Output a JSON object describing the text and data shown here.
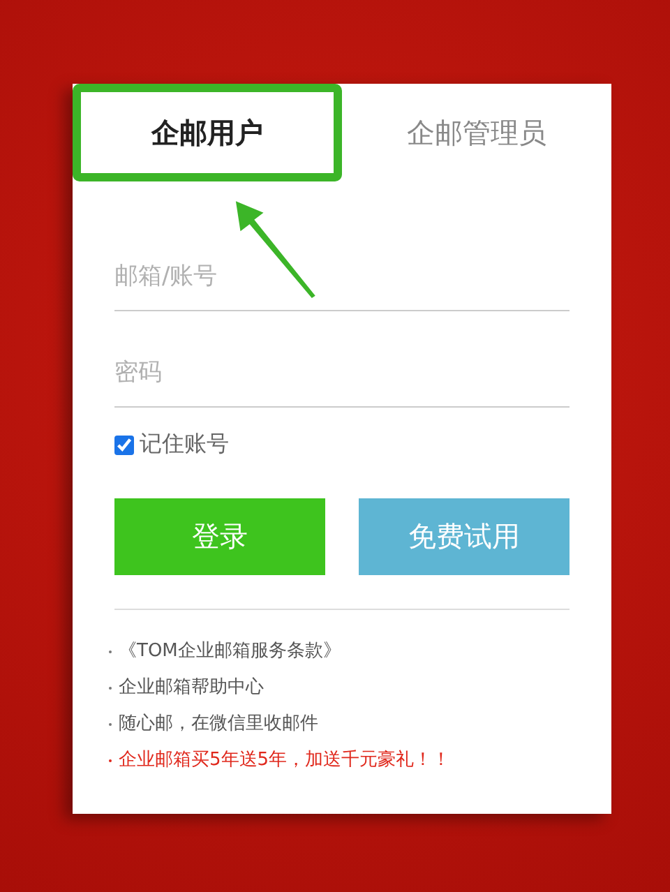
{
  "tabs": [
    {
      "label": "企邮用户",
      "selected": true,
      "highlighted": true
    },
    {
      "label": "企邮管理员",
      "selected": false,
      "highlighted": false
    }
  ],
  "fields": [
    {
      "placeholder": "邮箱/账号"
    },
    {
      "placeholder": "密码"
    }
  ],
  "remember": {
    "label": "记住账号",
    "checked": true
  },
  "buttons": [
    {
      "label": "登录",
      "kind": "primary"
    },
    {
      "label": "免费试用",
      "kind": "secondary"
    }
  ],
  "links": [
    {
      "text": "《TOM企业邮箱服务条款》",
      "kind": "normal"
    },
    {
      "text": "企业邮箱帮助中心",
      "kind": "normal"
    },
    {
      "text": "随心邮，在微信里收邮件",
      "kind": "normal"
    },
    {
      "text": "企业邮箱买5年送5年，加送千元豪礼！！",
      "kind": "promo"
    }
  ]
}
